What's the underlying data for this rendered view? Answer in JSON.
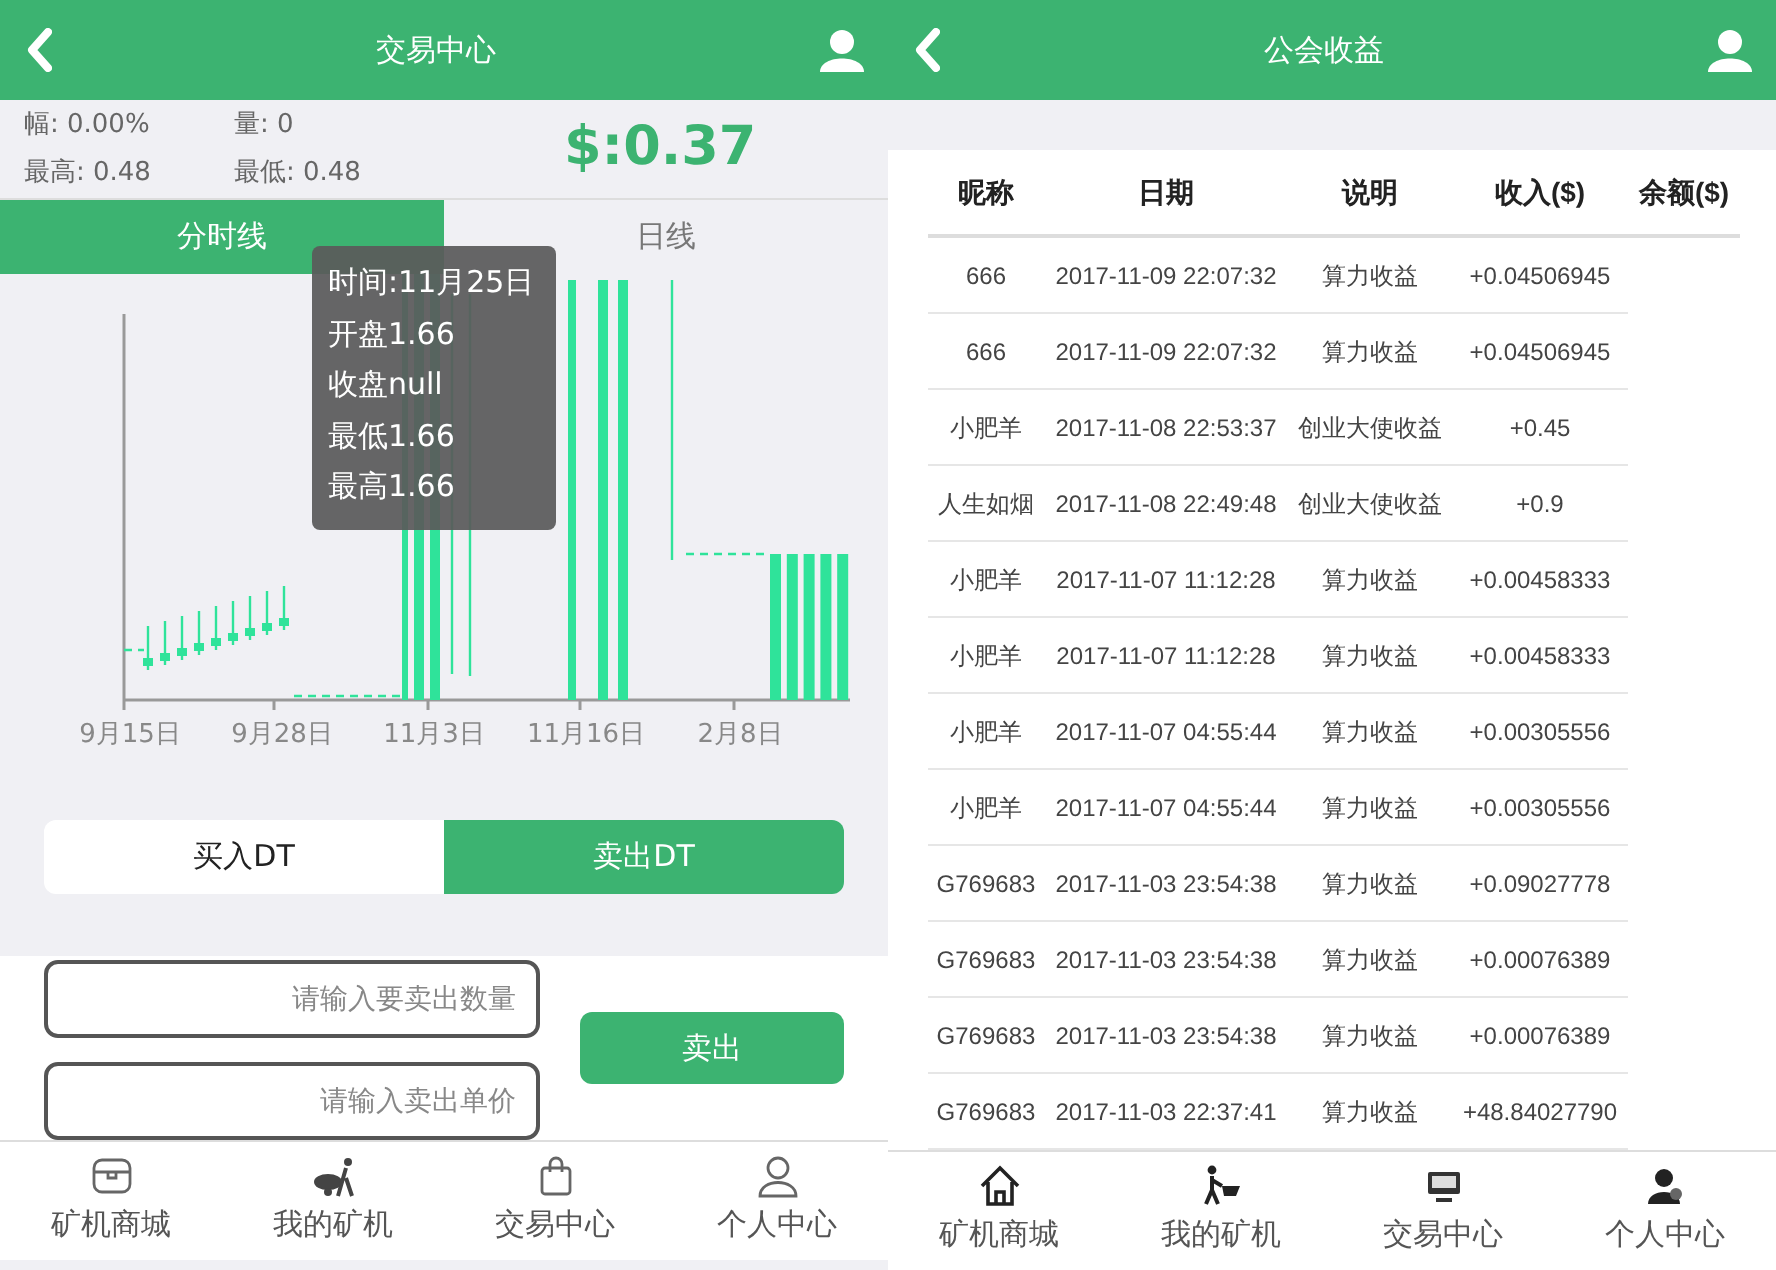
{
  "trade_screen": {
    "header": {
      "title": "交易中心"
    },
    "stats": [
      {
        "label": "幅: 0.00%"
      },
      {
        "label": "量: 0"
      },
      {
        "label": "最高: 0.48"
      },
      {
        "label": "最低: 0.48"
      }
    ],
    "price": "$:0.37",
    "tabs": [
      {
        "label": "分时线",
        "selected": true
      },
      {
        "label": "日线",
        "selected": false
      }
    ],
    "chart": {
      "x_labels": [
        "9月15日",
        "9月28日",
        "11月3日",
        "11月16日",
        "2月8日"
      ],
      "tooltip": [
        "时间:11月25日",
        "开盘1.66",
        "收盘null",
        "最低1.66",
        "最高1.66"
      ]
    },
    "trade_toggle": [
      {
        "label": "买入DT",
        "selected": false
      },
      {
        "label": "卖出DT",
        "selected": true
      }
    ],
    "form": {
      "fields": [
        {
          "placeholder": "请输入要卖出数量"
        },
        {
          "placeholder": "请输入卖出单价"
        }
      ],
      "submit": "卖出"
    },
    "bottom_nav": [
      {
        "label": "矿机商城",
        "kind": "store"
      },
      {
        "label": "我的矿机",
        "kind": "cart"
      },
      {
        "label": "交易中心",
        "kind": "bag"
      },
      {
        "label": "个人中心",
        "kind": "user"
      }
    ]
  },
  "income_screen": {
    "header": {
      "title": "公会收益"
    },
    "table": {
      "columns": [
        "昵称",
        "日期",
        "说明",
        "收入($)",
        "余额($)"
      ],
      "rows": [
        [
          "666",
          "2017-11-09 22:07:32",
          "算力收益",
          "+0.04506945"
        ],
        [
          "666",
          "2017-11-09 22:07:32",
          "算力收益",
          "+0.04506945"
        ],
        [
          "小肥羊",
          "2017-11-08 22:53:37",
          "创业大使收益",
          "+0.45"
        ],
        [
          "人生如烟",
          "2017-11-08 22:49:48",
          "创业大使收益",
          "+0.9"
        ],
        [
          "小肥羊",
          "2017-11-07 11:12:28",
          "算力收益",
          "+0.00458333"
        ],
        [
          "小肥羊",
          "2017-11-07 11:12:28",
          "算力收益",
          "+0.00458333"
        ],
        [
          "小肥羊",
          "2017-11-07 04:55:44",
          "算力收益",
          "+0.00305556"
        ],
        [
          "小肥羊",
          "2017-11-07 04:55:44",
          "算力收益",
          "+0.00305556"
        ],
        [
          "G769683",
          "2017-11-03 23:54:38",
          "算力收益",
          "+0.09027778"
        ],
        [
          "G769683",
          "2017-11-03 23:54:38",
          "算力收益",
          "+0.00076389"
        ],
        [
          "G769683",
          "2017-11-03 23:54:38",
          "算力收益",
          "+0.00076389"
        ],
        [
          "G769683",
          "2017-11-03 22:37:41",
          "算力收益",
          "+48.84027790"
        ]
      ]
    },
    "bottom_nav": [
      {
        "label": "矿机商城",
        "kind": "home"
      },
      {
        "label": "我的矿机",
        "kind": "walker"
      },
      {
        "label": "交易中心",
        "kind": "monitor"
      },
      {
        "label": "个人中心",
        "kind": "person"
      }
    ]
  }
}
